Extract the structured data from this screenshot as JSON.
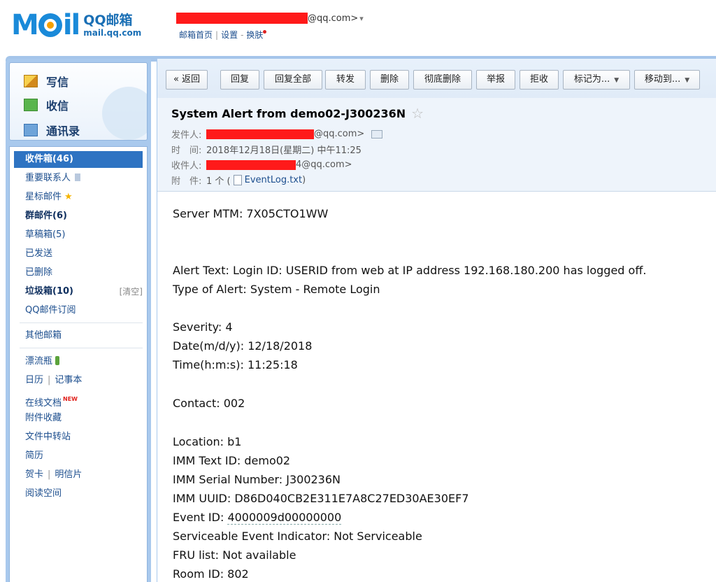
{
  "header": {
    "logo_main": "Mail",
    "logo_product": "QQ邮箱",
    "logo_url": "mail.qq.com",
    "account_suffix": "@qq.com>",
    "account_caret": "▾",
    "links": [
      "邮箱首页",
      "设置",
      "换肤"
    ]
  },
  "sidebar": {
    "compose": "写信",
    "receive": "收信",
    "contacts": "通讯录",
    "folders": [
      {
        "label": "收件箱(46)"
      },
      {
        "label": "重要联系人"
      },
      {
        "label": "星标邮件"
      },
      {
        "label": "群邮件(6)"
      },
      {
        "label": "草稿箱(5)"
      },
      {
        "label": "已发送"
      },
      {
        "label": "已删除"
      },
      {
        "label": "垃圾箱(10)",
        "action": "[清空]"
      },
      {
        "label": "QQ邮件订阅"
      }
    ],
    "other_mailbox": "其他邮箱",
    "apps": {
      "drift_bottle": "漂流瓶",
      "calendar": "日历",
      "notebook": "记事本",
      "online_docs": "在线文档",
      "new_badge": "NEW",
      "attachments": "附件收藏",
      "file_transfer": "文件中转站",
      "resume": "简历",
      "greeting_card": "贺卡",
      "postcard": "明信片",
      "reading_space": "阅读空间"
    }
  },
  "toolbar": {
    "back": "« 返回",
    "reply": "回复",
    "reply_all": "回复全部",
    "forward": "转发",
    "delete": "删除",
    "delete_permanent": "彻底删除",
    "report": "举报",
    "reject": "拒收",
    "mark_as": "标记为...",
    "move_to": "移动到..."
  },
  "mail": {
    "subject": "System Alert from demo02-J300236N",
    "from_label": "发件人:",
    "from_suffix": "@qq.com>",
    "time_label": "时　间:",
    "time_value": "2018年12月18日(星期二) 中午11:25",
    "to_label": "收件人:",
    "to_suffix": "4@qq.com>",
    "attach_label": "附　件:",
    "attach_count": "1 个 (",
    "attach_name": "EventLog.txt",
    "attach_close": ")",
    "body": {
      "server_mtm": "Server MTM: 7X05CTO1WW",
      "alert_text": "Alert Text: Login ID: USERID from web at IP address 192.168.180.200 has logged off.",
      "alert_type": "Type of Alert: System - Remote Login",
      "severity": "Severity: 4",
      "date": "Date(m/d/y): 12/18/2018",
      "time": "Time(h:m:s): 11:25:18",
      "contact": "Contact: 002",
      "location": "Location: b1",
      "imm_text_id": "IMM Text ID: demo02",
      "imm_serial": "IMM Serial Number: J300236N",
      "imm_uuid": "IMM UUID: D86D040CB2E311E7A8C27ED30AE30EF7",
      "event_id_label": "Event ID: ",
      "event_id_value": "4000009d00000000",
      "serviceable": "Serviceable Event Indicator: Not Serviceable",
      "fru_list": "FRU list: Not available",
      "room_id": "Room ID: 802"
    }
  },
  "colors": {
    "brand_blue": "#1a8ad9",
    "sidebar_blue": "#a9c9ed",
    "selected_folder": "#2e73c2",
    "redaction": "#ff1a1a"
  }
}
